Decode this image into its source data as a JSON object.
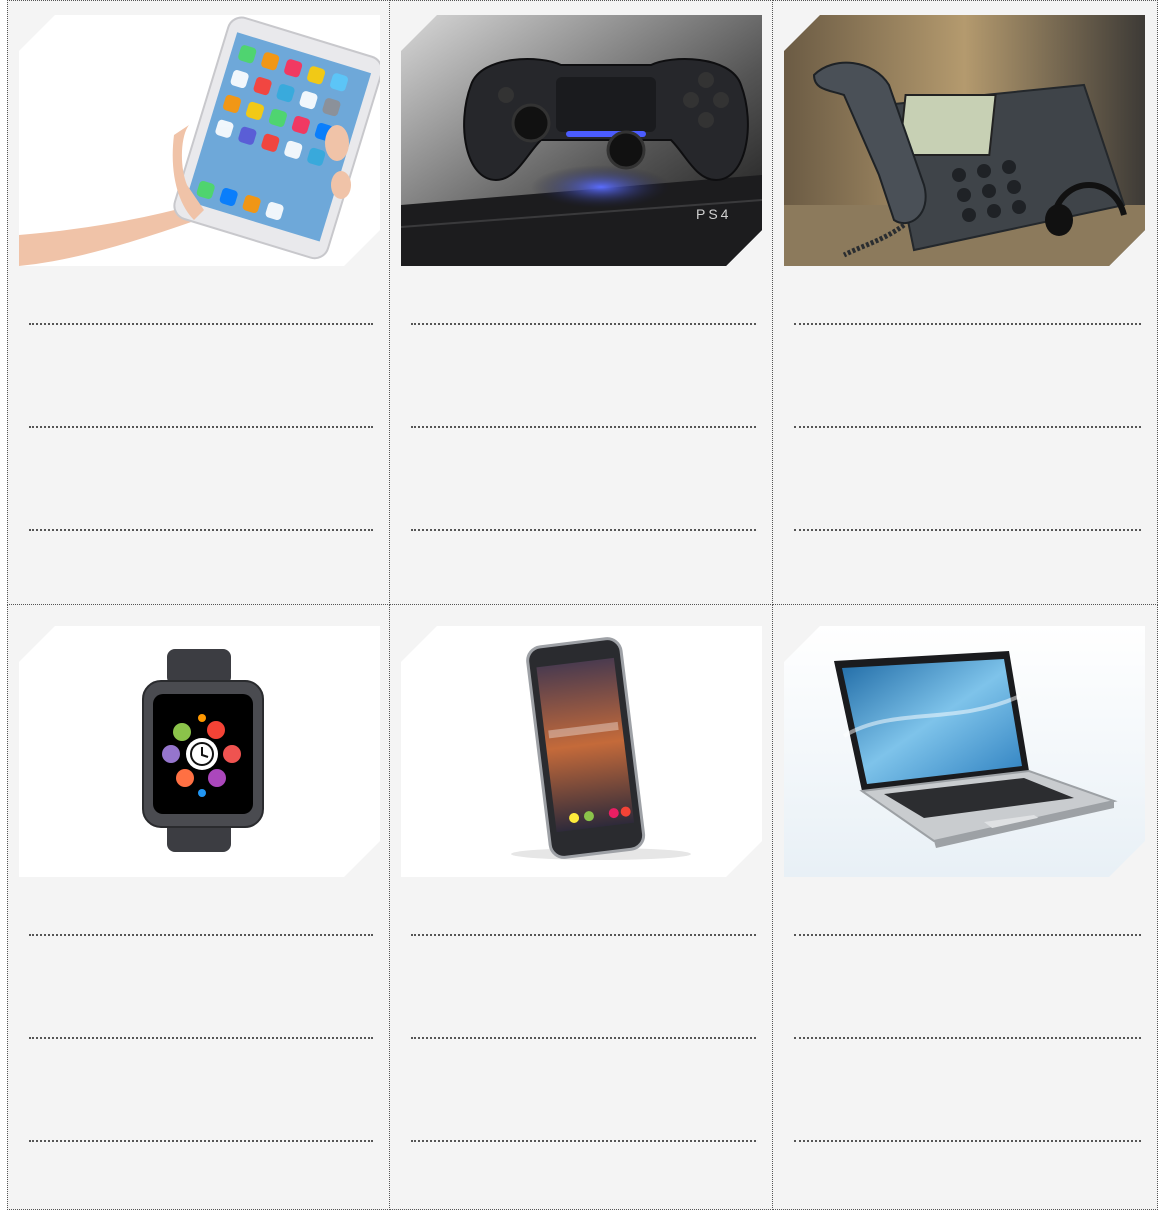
{
  "worksheet": {
    "cards": [
      {
        "device": "tablet-icon",
        "answers": [
          "",
          "",
          ""
        ]
      },
      {
        "device": "game-controller-icon",
        "answers": [
          "",
          "",
          ""
        ]
      },
      {
        "device": "desk-phone-icon",
        "answers": [
          "",
          "",
          ""
        ]
      },
      {
        "device": "smartwatch-icon",
        "answers": [
          "",
          "",
          ""
        ]
      },
      {
        "device": "smartphone-icon",
        "answers": [
          "",
          "",
          ""
        ]
      },
      {
        "device": "laptop-icon",
        "answers": [
          "",
          "",
          ""
        ]
      }
    ],
    "controller_brand": "PS4"
  }
}
